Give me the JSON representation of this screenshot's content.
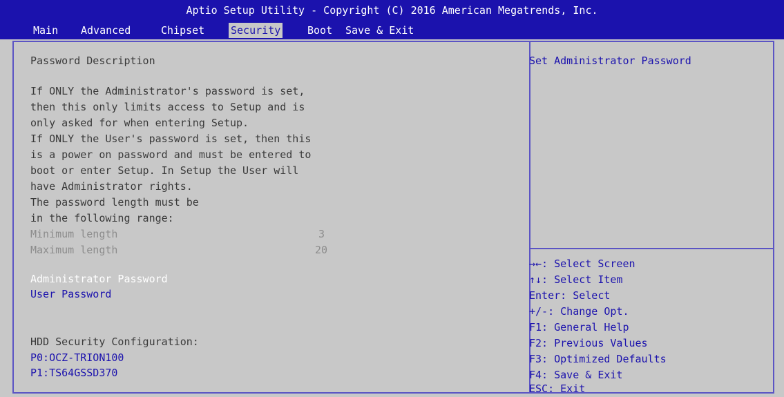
{
  "header": {
    "title": "Aptio Setup Utility - Copyright (C) 2016 American Megatrends, Inc.",
    "tabs": [
      {
        "label": "Main",
        "active": false
      },
      {
        "label": "Advanced",
        "active": false
      },
      {
        "label": "Chipset",
        "active": false
      },
      {
        "label": "Security",
        "active": true
      },
      {
        "label": "Boot",
        "active": false
      },
      {
        "label": "Save & Exit",
        "active": false
      }
    ]
  },
  "main": {
    "heading": "Password Description",
    "description": [
      "If ONLY the Administrator's password is set,",
      "then this only limits access to Setup and is",
      "only asked for when entering Setup.",
      "If ONLY the User's password is set, then this",
      "is a power on password and must be entered to",
      "boot or enter Setup. In Setup the User will",
      "have Administrator rights.",
      "The password length must be",
      "in the following range:"
    ],
    "min_length": {
      "label": "Minimum length",
      "value": "3"
    },
    "max_length": {
      "label": "Maximum length",
      "value": "20"
    },
    "admin_password": "Administrator Password",
    "user_password": "User Password",
    "hdd_heading": "HDD Security Configuration:",
    "hdd_items": [
      "P0:OCZ-TRION100",
      "P1:TS64GSSD370"
    ]
  },
  "help": {
    "text": "Set Administrator Password",
    "keys": [
      "→←: Select Screen",
      "↑↓: Select Item",
      "Enter: Select",
      "+/-: Change Opt.",
      "F1: General Help",
      "F2: Previous Values",
      "F3: Optimized Defaults",
      "F4: Save & Exit",
      "ESC: Exit"
    ]
  },
  "colors": {
    "header_bg": "#1b12ad",
    "panel_bg": "#c8c8c8",
    "border": "#5b54c4",
    "selected_item": "#ffffff",
    "item_text": "#1b12ad"
  }
}
